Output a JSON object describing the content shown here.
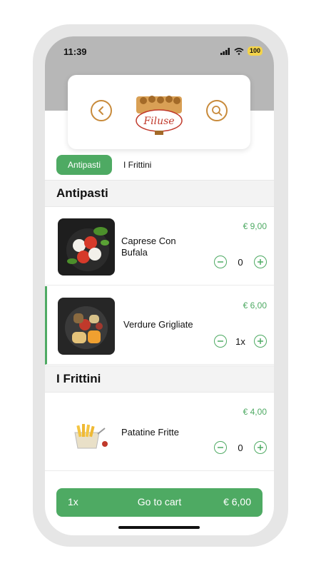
{
  "status_bar": {
    "time": "11:39",
    "battery": "100"
  },
  "header": {
    "logo_text": "Filuse"
  },
  "tabs": [
    {
      "label": "Antipasti",
      "active": true
    },
    {
      "label": "I Frittini",
      "active": false
    }
  ],
  "sections": [
    {
      "title": "Antipasti",
      "items": [
        {
          "name": "Caprese Con Bufala",
          "price": "€ 9,00",
          "quantity": "0"
        },
        {
          "name": "Verdure Grigliate",
          "price": "€ 6,00",
          "quantity": "1x"
        }
      ]
    },
    {
      "title": "I Frittini",
      "items": [
        {
          "name": "Patatine Fritte",
          "price": "€ 4,00",
          "quantity": "0"
        }
      ]
    }
  ],
  "cart": {
    "count": "1x",
    "label": "Go to cart",
    "total": "€ 6,00"
  },
  "colors": {
    "accent": "#4eaa63",
    "header_gray": "#b7b7b7",
    "brand_orange": "#c88a3a"
  }
}
